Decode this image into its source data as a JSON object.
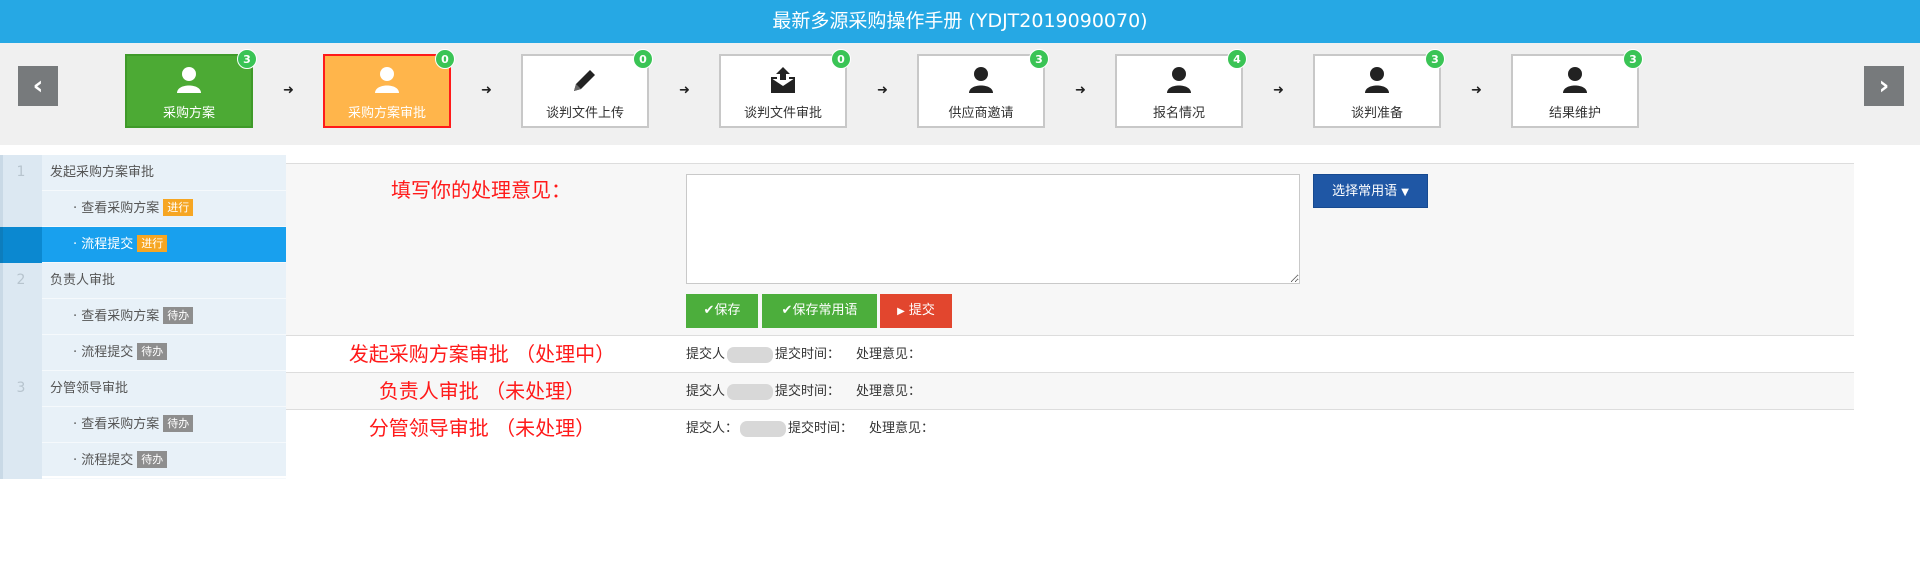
{
  "window": {
    "title": "最新多源采购操作手册 (YDJT2019090070)"
  },
  "nav": {
    "prev_label": "‹",
    "next_label": "›"
  },
  "steps": [
    {
      "label": "采购方案",
      "count": "3",
      "state": "done",
      "icon": "user-icon"
    },
    {
      "label": "采购方案审批",
      "count": "0",
      "state": "current",
      "icon": "user-icon"
    },
    {
      "label": "谈判文件上传",
      "count": "0",
      "state": "pending",
      "icon": "pencil-icon"
    },
    {
      "label": "谈判文件审批",
      "count": "0",
      "state": "pending",
      "icon": "envelope-upload-icon"
    },
    {
      "label": "供应商邀请",
      "count": "3",
      "state": "pending",
      "icon": "user-icon"
    },
    {
      "label": "报名情况",
      "count": "4",
      "state": "pending",
      "icon": "user-icon"
    },
    {
      "label": "谈判准备",
      "count": "3",
      "state": "pending",
      "icon": "user-icon"
    },
    {
      "label": "结果维护",
      "count": "3",
      "state": "pending",
      "icon": "user-icon"
    }
  ],
  "colors": {
    "accent": "#26a8e4",
    "done": "#4caa34",
    "current": "#ffb54b",
    "badge": "#3ac455",
    "dot_active": "#f6a623",
    "dot_inactive": "#f5d6a8"
  },
  "sidebar": {
    "items": [
      {
        "num": "1",
        "label": "发起采购方案审批"
      },
      {
        "label": "· 查看采购方案",
        "tag": "进行"
      },
      {
        "label": "· 流程提交",
        "tag": "进行"
      },
      {
        "num": "2",
        "label": "负责人审批"
      },
      {
        "label": "· 查看采购方案",
        "tag": "待办"
      },
      {
        "label": "· 流程提交",
        "tag": "待办"
      },
      {
        "num": "3",
        "label": "分管领导审批"
      },
      {
        "label": "· 查看采购方案",
        "tag": "待办"
      },
      {
        "label": "· 流程提交",
        "tag": "待办"
      }
    ]
  },
  "form": {
    "prompt": "填写你的处理意见：",
    "opinion_value": "",
    "phrase_button": "选择常用语",
    "save_button": "保存",
    "save_phrase_button": "保存常用语",
    "submit_button": "提交"
  },
  "records": [
    {
      "title": "发起采购方案审批 （处理中）",
      "submitter_label": "提交人",
      "time_label": "提交时间：",
      "opinion_label": "处理意见："
    },
    {
      "title": "负责人审批 （未处理）",
      "submitter_label": "提交人",
      "time_label": "提交时间：",
      "opinion_label": "处理意见："
    },
    {
      "title": "分管领导审批 （未处理）",
      "submitter_label": "提交人：",
      "time_label": "提交时间：",
      "opinion_label": "处理意见："
    }
  ]
}
